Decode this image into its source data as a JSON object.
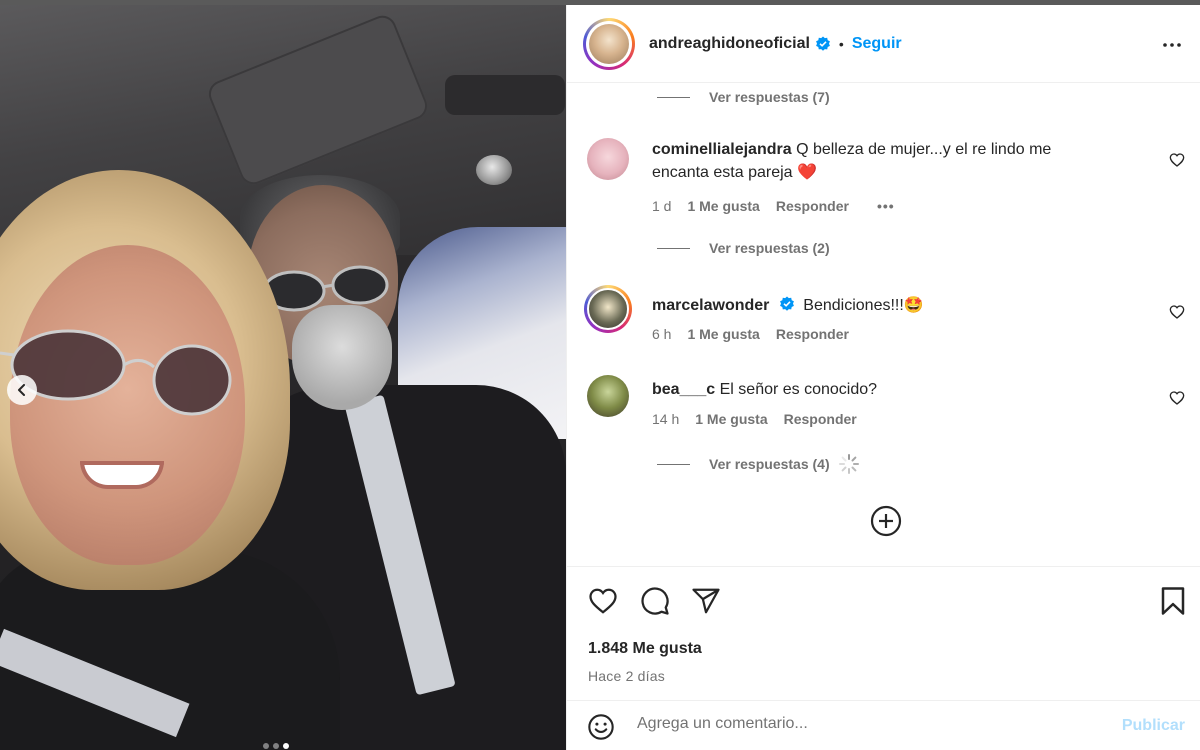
{
  "post": {
    "username": "andreaghidoneoficial",
    "separator": "•",
    "follow_label": "Seguir",
    "likes": "1.848 Me gusta",
    "date": "Hace 2 días"
  },
  "comments": [
    {
      "replies_label": "Ver respuestas (7)"
    },
    {
      "username": "cominellialejandra",
      "text": "Q belleza de mujer...y el re lindo me encanta esta pareja",
      "emoji": "❤️",
      "age": "1 d",
      "likes": "1 Me gusta",
      "reply_label": "Responder",
      "more": "•••",
      "replies_label": "Ver respuestas (2)"
    },
    {
      "username": "marcelawonder",
      "text": "Bendiciones!!!",
      "emoji": "🤩",
      "age": "6 h",
      "likes": "1 Me gusta",
      "reply_label": "Responder"
    },
    {
      "username": "bea___c",
      "text": "El señor es conocido?",
      "age": "14 h",
      "likes": "1 Me gusta",
      "reply_label": "Responder",
      "replies_label": "Ver respuestas (4)"
    }
  ],
  "composer": {
    "placeholder": "Agrega un comentario...",
    "publish_label": "Publicar"
  },
  "carousel": {
    "count": 3,
    "active_index": 2
  },
  "colors": {
    "accent": "#0095f6",
    "muted": "#737373",
    "publish_disabled": "#b2dffc",
    "heart_red": "#e0245e"
  }
}
